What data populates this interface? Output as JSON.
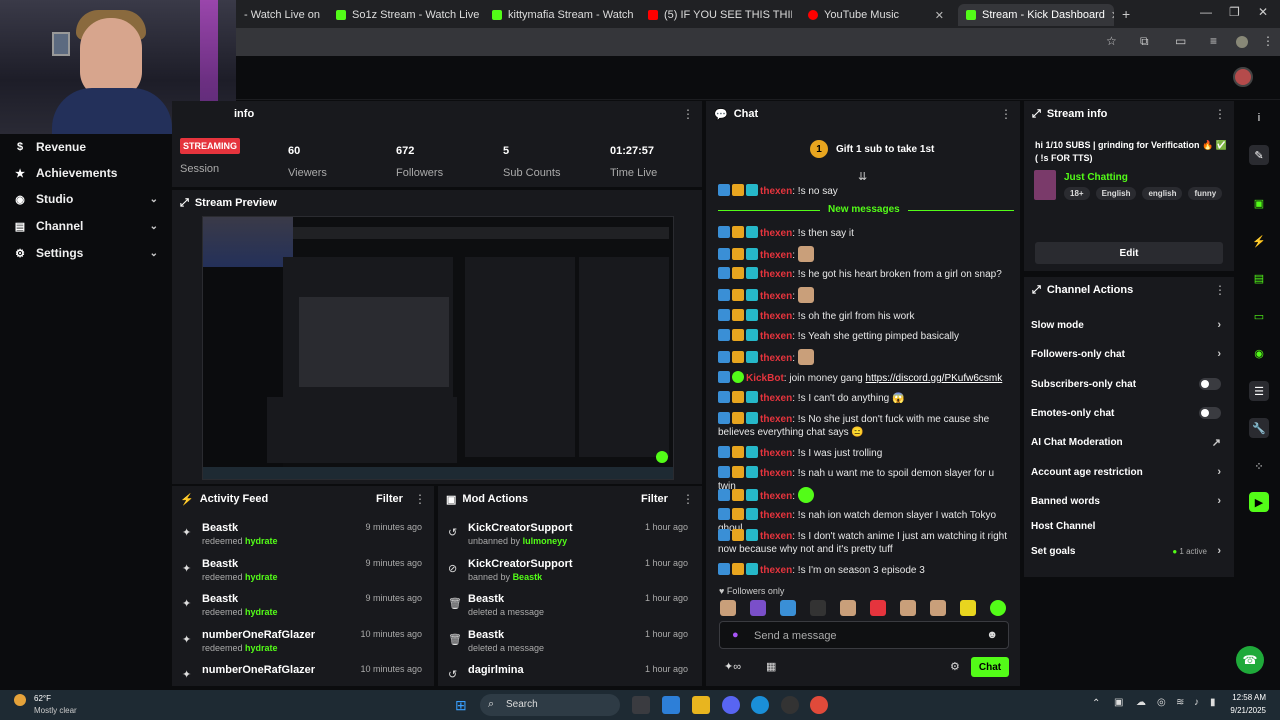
{
  "browser": {
    "tabs": [
      {
        "label": "- Watch Live on",
        "color": "#53fc18"
      },
      {
        "label": "So1z Stream - Watch Live on Ki",
        "color": "#53fc18"
      },
      {
        "label": "kittymafia Stream - Watch Live",
        "color": "#53fc18"
      },
      {
        "label": "(5) IF YOU SEE THIS THING.. RU",
        "color": "#ff0000"
      },
      {
        "label": "YouTube Music",
        "color": "#ff0000"
      },
      {
        "label": "Stream - Kick Dashboard",
        "color": "#53fc18"
      }
    ]
  },
  "sidebar": {
    "items": [
      {
        "label": "Revenue",
        "icon": "dollar-icon",
        "chev": ""
      },
      {
        "label": "Achievements",
        "icon": "star-icon",
        "chev": ""
      },
      {
        "label": "Studio",
        "icon": "studio-icon",
        "chev": "⌄"
      },
      {
        "label": "Channel",
        "icon": "channel-icon",
        "chev": "⌄"
      },
      {
        "label": "Settings",
        "icon": "gear-icon",
        "chev": "⌄"
      }
    ]
  },
  "session": {
    "title": "info",
    "badge": "STREAMING",
    "session_label": "Session",
    "stats": [
      {
        "value": "60",
        "label": "Viewers"
      },
      {
        "value": "672",
        "label": "Followers"
      },
      {
        "value": "5",
        "label": "Sub Counts"
      },
      {
        "value": "01:27:57",
        "label": "Time Live"
      }
    ]
  },
  "preview": {
    "title": "Stream Preview"
  },
  "activity": {
    "title": "Activity Feed",
    "filter": "Filter",
    "rows": [
      {
        "name": "Beastk",
        "action": "redeemed",
        "item": "hydrate",
        "time": "9 minutes ago"
      },
      {
        "name": "Beastk",
        "action": "redeemed",
        "item": "hydrate",
        "time": "9 minutes ago"
      },
      {
        "name": "Beastk",
        "action": "redeemed",
        "item": "hydrate",
        "time": "9 minutes ago"
      },
      {
        "name": "numberOneRafGlazer",
        "action": "redeemed",
        "item": "hydrate",
        "time": "10 minutes ago"
      },
      {
        "name": "numberOneRafGlazer",
        "action": "",
        "item": "",
        "time": "10 minutes ago"
      }
    ]
  },
  "mod": {
    "title": "Mod Actions",
    "filter": "Filter",
    "rows": [
      {
        "name": "KickCreatorSupport",
        "action": "unbanned by",
        "item": "lulmoneyy",
        "time": "1 hour ago",
        "icon": "undo-icon"
      },
      {
        "name": "KickCreatorSupport",
        "action": "banned by",
        "item": "Beastk",
        "time": "1 hour ago",
        "icon": "ban-icon"
      },
      {
        "name": "Beastk",
        "action": "deleted a message",
        "item": "",
        "time": "1 hour ago",
        "icon": "trash-icon"
      },
      {
        "name": "Beastk",
        "action": "deleted a message",
        "item": "",
        "time": "1 hour ago",
        "icon": "trash-icon"
      },
      {
        "name": "dagirlmina",
        "action": "",
        "item": "",
        "time": "1 hour ago",
        "icon": "undo-icon"
      }
    ]
  },
  "chat": {
    "title": "Chat",
    "gift": "Gift 1 sub to take 1st",
    "new_messages": "New messages",
    "followers_only": "Followers only",
    "placeholder": "Send a message",
    "send": "Chat",
    "messages": [
      {
        "user": "thexen",
        "text": ": !s no say"
      },
      {
        "user": "thexen",
        "text": ": !s then say it"
      },
      {
        "user": "thexen",
        "text": ":",
        "emote": true
      },
      {
        "user": "thexen",
        "text": ": !s he got his heart broken from a girl on snap?"
      },
      {
        "user": "thexen",
        "text": ":",
        "emote": true
      },
      {
        "user": "thexen",
        "text": ": !s oh the girl from his work"
      },
      {
        "user": "thexen",
        "text": ": !s Yeah she getting pimped basically"
      },
      {
        "user": "thexen",
        "text": ":",
        "emote": true
      },
      {
        "user": "KickBot",
        "text": ": join money gang ",
        "link": "https://discord.gg/PKufw6csmk"
      },
      {
        "user": "thexen",
        "text": ": !s I can't do anything 😱"
      },
      {
        "user": "thexen",
        "text": ": !s No she just don't fuck with me cause she believes everything chat says 😑"
      },
      {
        "user": "thexen",
        "text": ": !s I was just trolling"
      },
      {
        "user": "thexen",
        "text": ": !s nah u want me to spoil demon slayer for u twin"
      },
      {
        "user": "thexen",
        "text": ":",
        "emote": true,
        "green": true
      },
      {
        "user": "thexen",
        "text": ": !s nah ion watch demon slayer I watch Tokyo ghoul"
      },
      {
        "user": "thexen",
        "text": ": !s I don't watch anime I just am watching it right now because why not and it's pretty tuff"
      },
      {
        "user": "thexen",
        "text": ": !s I'm on season 3 episode 3"
      }
    ]
  },
  "streaminfo": {
    "title": "Stream info",
    "stream_title": "hi 1/10 SUBS | grinding for Verification 🔥 ✅ ( !s FOR TTS)",
    "category": "Just Chatting",
    "tags": [
      "18+",
      "English",
      "english",
      "funny"
    ],
    "edit": "Edit"
  },
  "actions": {
    "title": "Channel Actions",
    "items": [
      {
        "label": "Slow mode",
        "ctl": "›"
      },
      {
        "label": "Followers-only chat",
        "ctl": "›"
      },
      {
        "label": "Subscribers-only chat",
        "ctl": "toggle"
      },
      {
        "label": "Emotes-only chat",
        "ctl": "toggle"
      },
      {
        "label": "AI Chat Moderation",
        "ctl": "↗"
      },
      {
        "label": "Account age restriction",
        "ctl": "›"
      },
      {
        "label": "Banned words",
        "ctl": "›"
      },
      {
        "label": "Host Channel",
        "ctl": ""
      },
      {
        "label": "Set goals",
        "ctl": "› ",
        "extra": "1 active"
      }
    ]
  },
  "taskbar": {
    "weather_temp": "62°F",
    "weather_desc": "Mostly clear",
    "search": "Search",
    "time": "12:58 AM",
    "date": "9/21/2025"
  }
}
